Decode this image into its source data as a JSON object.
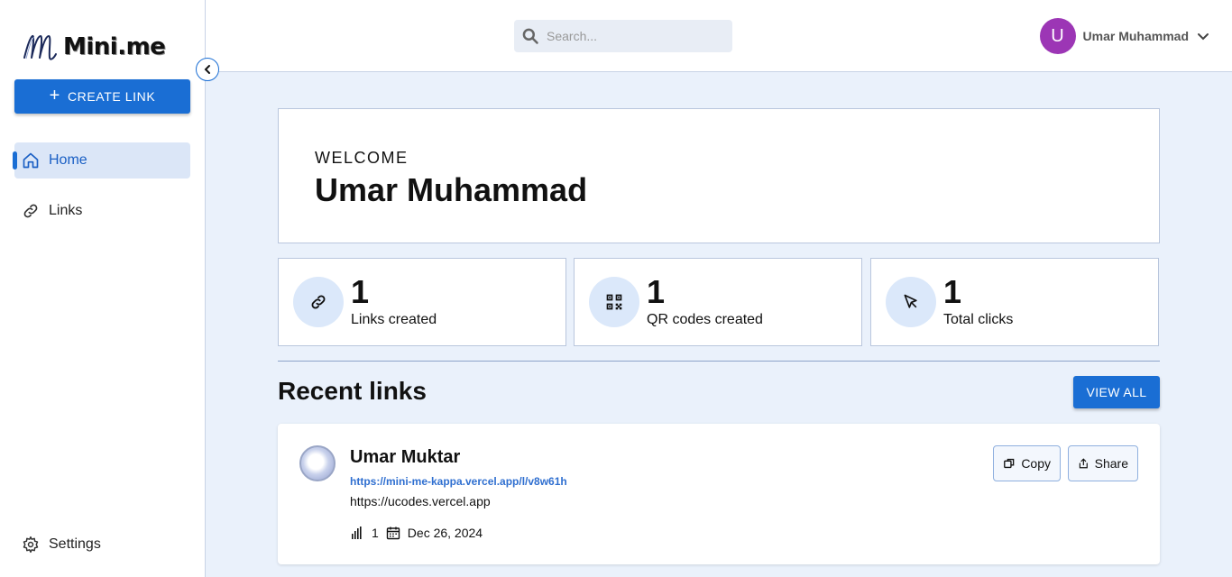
{
  "app": {
    "logo_text": "Mini.me"
  },
  "sidebar": {
    "create_label": "CREATE LINK",
    "items": [
      {
        "label": "Home",
        "icon": "home-icon",
        "active": true
      },
      {
        "label": "Links",
        "icon": "link-icon",
        "active": false
      }
    ],
    "settings_label": "Settings"
  },
  "header": {
    "search_placeholder": "Search...",
    "user": {
      "initial": "U",
      "name": "Umar Muhammad",
      "avatar_color": "#9c36b5"
    }
  },
  "welcome": {
    "label": "WELCOME",
    "name": "Umar Muhammad"
  },
  "stats": [
    {
      "value": "1",
      "label": "Links created",
      "icon": "link-icon"
    },
    {
      "value": "1",
      "label": "QR codes created",
      "icon": "qr-code-icon"
    },
    {
      "value": "1",
      "label": "Total clicks",
      "icon": "cursor-icon"
    }
  ],
  "recent": {
    "title": "Recent links",
    "view_all_label": "VIEW ALL",
    "links": [
      {
        "title": "Umar Muktar",
        "short_url": "https://mini-me-kappa.vercel.app/l/v8w61h",
        "original_url": "https://ucodes.vercel.app",
        "clicks": "1",
        "date": "Dec 26, 2024",
        "copy_label": "Copy",
        "share_label": "Share"
      }
    ]
  },
  "colors": {
    "primary": "#1a6ed4",
    "background": "#eaf1fb",
    "avatar": "#9c36b5"
  }
}
